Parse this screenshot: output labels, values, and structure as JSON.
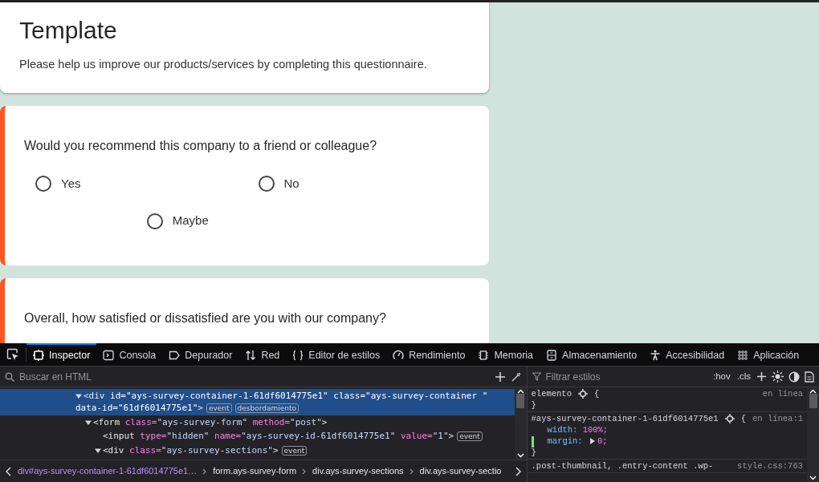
{
  "survey": {
    "title": "Template",
    "description": "Please help us improve our products/services by completing this questionnaire.",
    "questions": [
      {
        "text": "Would you recommend this company to a friend or colleague?",
        "options": [
          {
            "label": "Yes",
            "selected": false
          },
          {
            "label": "No",
            "selected": false
          },
          {
            "label": "Maybe",
            "selected": false
          }
        ]
      },
      {
        "text": "Overall, how satisfied or dissatisfied are you with our company?"
      }
    ]
  },
  "devtools": {
    "tabs": [
      {
        "label": "Inspector",
        "selected": true
      },
      {
        "label": "Consola",
        "selected": false
      },
      {
        "label": "Depurador",
        "selected": false
      },
      {
        "label": "Red",
        "selected": false
      },
      {
        "label": "Editor de estilos",
        "selected": false
      },
      {
        "label": "Rendimiento",
        "selected": false
      },
      {
        "label": "Memoria",
        "selected": false
      },
      {
        "label": "Almacenamiento",
        "selected": false
      },
      {
        "label": "Accesibilidad",
        "selected": false
      },
      {
        "label": "Aplicación",
        "selected": false
      }
    ],
    "html_search": {
      "placeholder": "Buscar en HTML"
    },
    "tree": [
      {
        "selected": true,
        "expanded": true,
        "segments": [
          {
            "kind": "tag",
            "t": "<div"
          },
          {
            "kind": "attr",
            "t": " id="
          },
          {
            "kind": "value",
            "t": "\"ays-survey-container-1-61df6014775e1\""
          },
          {
            "kind": "attr",
            "t": " class="
          },
          {
            "kind": "value",
            "t": "\"ays-survey-container \""
          },
          {
            "kind": "attr",
            "t": " data-id="
          },
          {
            "kind": "value",
            "t": "\"61df6014775e1\""
          },
          {
            "kind": "tag",
            "t": ">"
          }
        ],
        "badges": [
          "event",
          "desbordamiento"
        ],
        "children": [
          {
            "selected": false,
            "expanded": true,
            "segments": [
              {
                "kind": "tag",
                "t": "<form"
              },
              {
                "kind": "attr",
                "t": " class="
              },
              {
                "kind": "value",
                "t": "\"ays-survey-form\""
              },
              {
                "kind": "attr",
                "t": " method="
              },
              {
                "kind": "value",
                "t": "\"post\""
              },
              {
                "kind": "tag",
                "t": ">"
              }
            ],
            "children": [
              {
                "selected": false,
                "segments": [
                  {
                    "kind": "tag",
                    "t": "<input"
                  },
                  {
                    "kind": "attr",
                    "t": " type="
                  },
                  {
                    "kind": "value",
                    "t": "\"hidden\""
                  },
                  {
                    "kind": "attr",
                    "t": " name="
                  },
                  {
                    "kind": "value",
                    "t": "\"ays-survey-id-61df6014775e1\""
                  },
                  {
                    "kind": "attr",
                    "t": " value="
                  },
                  {
                    "kind": "value",
                    "t": "\"1\""
                  },
                  {
                    "kind": "tag",
                    "t": ">"
                  }
                ],
                "badges": [
                  "event"
                ]
              },
              {
                "selected": false,
                "expanded": true,
                "segments": [
                  {
                    "kind": "tag",
                    "t": "<div"
                  },
                  {
                    "kind": "attr",
                    "t": " class="
                  },
                  {
                    "kind": "value",
                    "t": "\"ays-survey-sections\""
                  },
                  {
                    "kind": "tag",
                    "t": ">"
                  }
                ],
                "badges": [
                  "event"
                ]
              }
            ]
          }
        ]
      }
    ],
    "breadcrumbs": [
      "div#ays-survey-container-1-61df6014775e1…",
      "form.ays-survey-form",
      "div.ays-survey-sections",
      "div.ays-survey-sectio"
    ],
    "styles_filter": {
      "placeholder": "Filtrar estilos"
    },
    "style_buttons": [
      ":hov",
      ".cls"
    ],
    "rules": [
      {
        "selector": "elemento",
        "open": "{",
        "close": "}",
        "source": "en línea"
      },
      {
        "selector": "#ays-survey-container-1-61df6014775e1",
        "open": "{",
        "close": "}",
        "source": "en línea:1",
        "declarations": [
          {
            "property": "width:",
            "value": "100%;",
            "changed": false,
            "expandable": false
          },
          {
            "property": "margin:",
            "value": "0;",
            "changed": true,
            "expandable": true
          }
        ]
      },
      {
        "selector": ".post-thumbnail, .entry-content .wp-",
        "source": "style.css:763"
      }
    ]
  }
}
